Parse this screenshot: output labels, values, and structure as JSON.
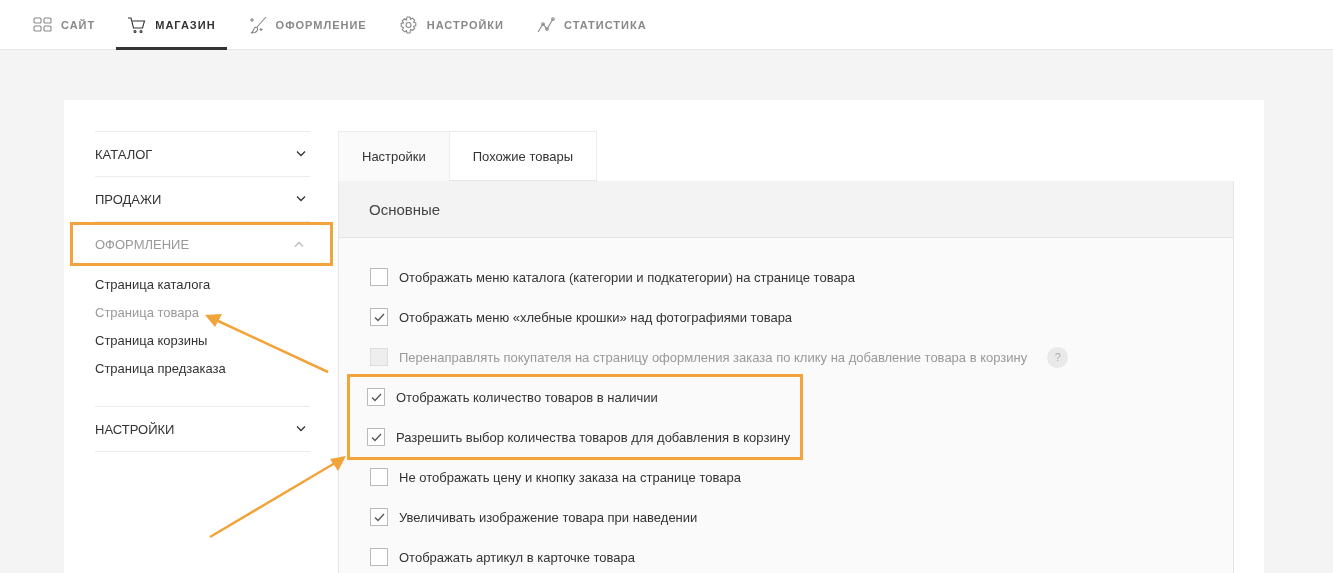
{
  "top_nav": [
    {
      "label": "САЙТ",
      "selected": false
    },
    {
      "label": "МАГАЗИН",
      "selected": true
    },
    {
      "label": "ОФОРМЛЕНИЕ",
      "selected": false
    },
    {
      "label": "НАСТРОЙКИ",
      "selected": false
    },
    {
      "label": "СТАТИСТИКА",
      "selected": false
    }
  ],
  "sidebar": {
    "sections": [
      {
        "label": "КАТАЛОГ",
        "expanded": false,
        "highlighted": false
      },
      {
        "label": "ПРОДАЖИ",
        "expanded": false,
        "highlighted": false
      },
      {
        "label": "ОФОРМЛЕНИЕ",
        "expanded": true,
        "highlighted": true,
        "children": [
          {
            "label": "Страница каталога",
            "selected": false
          },
          {
            "label": "Страница товара",
            "selected": true
          },
          {
            "label": "Страница корзины",
            "selected": false
          },
          {
            "label": "Страница предзаказа",
            "selected": false
          }
        ]
      },
      {
        "label": "НАСТРОЙКИ",
        "expanded": false,
        "highlighted": false
      }
    ]
  },
  "tabs": [
    {
      "label": "Настройки",
      "selected": true
    },
    {
      "label": "Похожие товары",
      "selected": false
    }
  ],
  "panel": {
    "title": "Основные",
    "options": [
      {
        "label": "Отображать меню каталога (категории и подкатегории) на странице товара",
        "checked": false,
        "disabled": false,
        "highlighted": false
      },
      {
        "label": "Отображать меню «хлебные крошки» над фотографиями товара",
        "checked": true,
        "disabled": false,
        "highlighted": false
      },
      {
        "label": "Перенаправлять покупателя на страницу оформления заказа по клику на добавление товара в корзину",
        "checked": false,
        "disabled": true,
        "highlighted": false,
        "help": "?"
      },
      {
        "label": "Отображать количество товаров в наличии",
        "checked": true,
        "disabled": false,
        "highlighted": true
      },
      {
        "label": "Разрешить выбор количества товаров для добавления в корзину",
        "checked": true,
        "disabled": false,
        "highlighted": true
      },
      {
        "label": "Не отображать цену и кнопку заказа на странице товара",
        "checked": false,
        "disabled": false,
        "highlighted": false
      },
      {
        "label": "Увеличивать изображение товара при наведении",
        "checked": true,
        "disabled": false,
        "highlighted": false
      },
      {
        "label": "Отображать артикул в карточке товара",
        "checked": false,
        "disabled": false,
        "highlighted": false
      }
    ]
  }
}
